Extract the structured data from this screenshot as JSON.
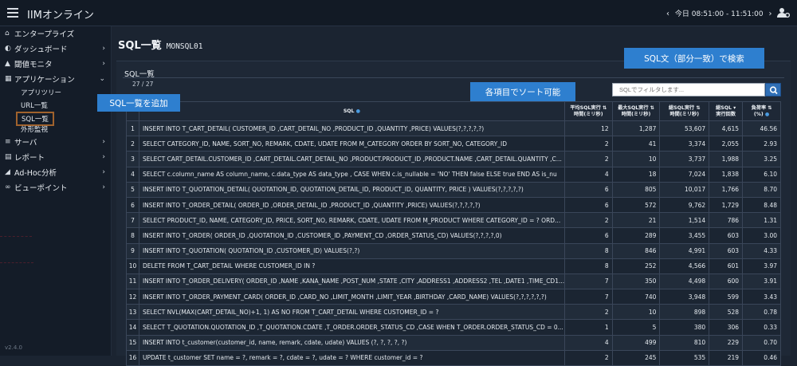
{
  "header": {
    "brand": "IIMオンライン",
    "time_range": "今日 08:51:00 - 11:51:00"
  },
  "sidebar": {
    "items": [
      {
        "label": "エンタープライズ",
        "icon": "home-icon",
        "chevron": ""
      },
      {
        "label": "ダッシュボード",
        "icon": "dashboard-icon",
        "chevron": "›"
      },
      {
        "label": "閾値モニタ",
        "icon": "warning-icon",
        "chevron": "›"
      },
      {
        "label": "アプリケーション",
        "icon": "grid-icon",
        "chevron": "⌄"
      },
      {
        "label": "サーバ",
        "icon": "server-icon",
        "chevron": "›"
      },
      {
        "label": "レポート",
        "icon": "document-icon",
        "chevron": "›"
      },
      {
        "label": "Ad-Hoc分析",
        "icon": "chart-icon",
        "chevron": "›"
      },
      {
        "label": "ビューポイント",
        "icon": "binoculars-icon",
        "chevron": "›"
      }
    ],
    "subitems": [
      "アプリツリー",
      "URL一覧",
      "SQL一覧",
      "外形監視"
    ],
    "version": "v2.4.0"
  },
  "page": {
    "title": "SQL一覧",
    "db": "MONSQL01"
  },
  "panel": {
    "title": "SQL一覧",
    "count": "27 / 27",
    "search_placeholder": "SQLでフィルタします..."
  },
  "table": {
    "headers": {
      "sql": "SQL",
      "avg": [
        "平均SQL実行",
        "時間(ミリ秒)"
      ],
      "max": [
        "最大SQL実行",
        "時間(ミリ秒)"
      ],
      "total": [
        "総SQL実行",
        "時間(ミリ秒)"
      ],
      "runs": [
        "総SQL",
        "実行回数"
      ],
      "load": [
        "負荷率",
        "(%)"
      ]
    },
    "rows": [
      {
        "n": "1",
        "sql": "INSERT INTO T_CART_DETAIL( CUSTOMER_ID ,CART_DETAIL_NO ,PRODUCT_ID ,QUANTITY ,PRICE) VALUES(?,?,?,?,?)",
        "avg": "12",
        "max": "1,287",
        "total": "53,607",
        "runs": "4,615",
        "load": "46.56"
      },
      {
        "n": "2",
        "sql": "SELECT CATEGORY_ID, NAME, SORT_NO, REMARK, CDATE, UDATE FROM M_CATEGORY ORDER BY SORT_NO, CATEGORY_ID",
        "avg": "2",
        "max": "41",
        "total": "3,374",
        "runs": "2,055",
        "load": "2.93"
      },
      {
        "n": "3",
        "sql": "SELECT CART_DETAIL.CUSTOMER_ID ,CART_DETAIL.CART_DETAIL_NO ,PRODUCT.PRODUCT_ID ,PRODUCT.NAME ,CART_DETAIL.QUANTITY ,C...",
        "avg": "2",
        "max": "10",
        "total": "3,737",
        "runs": "1,988",
        "load": "3.25"
      },
      {
        "n": "4",
        "sql": "SELECT c.column_name AS column_name, c.data_type AS data_type , CASE WHEN c.is_nullable = 'NO' THEN false ELSE true END AS is_nu",
        "avg": "4",
        "max": "18",
        "total": "7,024",
        "runs": "1,838",
        "load": "6.10"
      },
      {
        "n": "5",
        "sql": "INSERT INTO T_QUOTATION_DETAIL( QUOTATION_ID, QUOTATION_DETAIL_ID, PRODUCT_ID, QUANTITY, PRICE ) VALUES(?,?,?,?,?)",
        "avg": "6",
        "max": "805",
        "total": "10,017",
        "runs": "1,766",
        "load": "8.70"
      },
      {
        "n": "6",
        "sql": "INSERT INTO T_ORDER_DETAIL( ORDER_ID ,ORDER_DETAIL_ID ,PRODUCT_ID ,QUANTITY ,PRICE) VALUES(?,?,?,?,?)",
        "avg": "6",
        "max": "572",
        "total": "9,762",
        "runs": "1,729",
        "load": "8.48"
      },
      {
        "n": "7",
        "sql": "SELECT PRODUCT_ID, NAME, CATEGORY_ID, PRICE, SORT_NO, REMARK, CDATE, UDATE FROM M_PRODUCT WHERE CATEGORY_ID = ? ORD...",
        "avg": "2",
        "max": "21",
        "total": "1,514",
        "runs": "786",
        "load": "1.31"
      },
      {
        "n": "8",
        "sql": "INSERT INTO T_ORDER( ORDER_ID ,QUOTATION_ID ,CUSTOMER_ID ,PAYMENT_CD ,ORDER_STATUS_CD) VALUES(?,?,?,?,0)",
        "avg": "6",
        "max": "289",
        "total": "3,455",
        "runs": "603",
        "load": "3.00"
      },
      {
        "n": "9",
        "sql": "INSERT INTO T_QUOTATION( QUOTATION_ID ,CUSTOMER_ID) VALUES(?,?)",
        "avg": "8",
        "max": "846",
        "total": "4,991",
        "runs": "603",
        "load": "4.33"
      },
      {
        "n": "10",
        "sql": "DELETE FROM T_CART_DETAIL WHERE CUSTOMER_ID IN ?",
        "avg": "8",
        "max": "252",
        "total": "4,566",
        "runs": "601",
        "load": "3.97"
      },
      {
        "n": "11",
        "sql": "INSERT INTO T_ORDER_DELIVERY( ORDER_ID ,NAME ,KANA_NAME ,POST_NUM ,STATE ,CITY ,ADDRESS1 ,ADDRESS2 ,TEL ,DATE1 ,TIME_CD1...",
        "avg": "7",
        "max": "350",
        "total": "4,498",
        "runs": "600",
        "load": "3.91"
      },
      {
        "n": "12",
        "sql": "INSERT INTO T_ORDER_PAYMENT_CARD( ORDER_ID ,CARD_NO ,LIMIT_MONTH ,LIMIT_YEAR ,BIRTHDAY ,CARD_NAME) VALUES(?,?,?,?,?,?)",
        "avg": "7",
        "max": "740",
        "total": "3,948",
        "runs": "599",
        "load": "3.43"
      },
      {
        "n": "13",
        "sql": "SELECT NVL(MAX(CART_DETAIL_NO)+1, 1) AS NO FROM T_CART_DETAIL WHERE CUSTOMER_ID = ?",
        "avg": "2",
        "max": "10",
        "total": "898",
        "runs": "528",
        "load": "0.78"
      },
      {
        "n": "14",
        "sql": "SELECT T_QUOTATION.QUOTATION_ID ,T_QUOTATION.CDATE ,T_ORDER.ORDER_STATUS_CD ,CASE WHEN T_ORDER.ORDER_STATUS_CD = 0...",
        "avg": "1",
        "max": "5",
        "total": "380",
        "runs": "306",
        "load": "0.33"
      },
      {
        "n": "15",
        "sql": "INSERT INTO t_customer(customer_id, name, remark, cdate, udate) VALUES (?, ?, ?, ?, ?)",
        "avg": "4",
        "max": "499",
        "total": "810",
        "runs": "229",
        "load": "0.70"
      },
      {
        "n": "16",
        "sql": "UPDATE t_customer SET name = ?, remark = ?, cdate = ?, udate = ? WHERE customer_id = ?",
        "avg": "2",
        "max": "245",
        "total": "535",
        "runs": "219",
        "load": "0.46"
      }
    ]
  },
  "callouts": {
    "add": "SQL一覧を追加",
    "sort": "各項目でソート可能",
    "search": "SQL文（部分一致）で検索"
  },
  "colors": {
    "accent": "#2e7fcf",
    "highlight_border": "#a0622d"
  }
}
